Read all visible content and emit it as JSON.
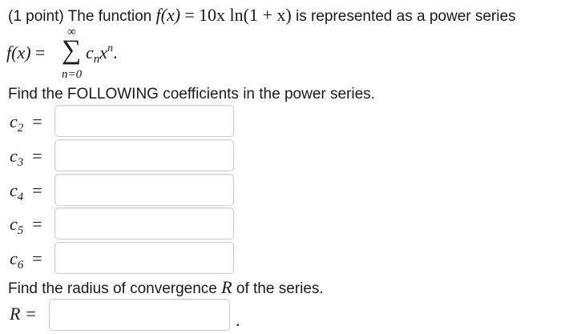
{
  "problem": {
    "points": "(1 point)",
    "intro": "The function",
    "function_lhs": "f(x)",
    "equals": "=",
    "function_rhs": "10x ln(1 + x)",
    "outro": "is represented as a power series"
  },
  "series": {
    "lhs": "f(x)",
    "equals": "=",
    "upper_limit": "∞",
    "sigma": "∑",
    "lower_limit": "n=0",
    "coef": "c",
    "coef_sub": "n",
    "var": "x",
    "var_sup": "n",
    "end": "."
  },
  "instructions": {
    "find_coefficients": "Find the FOLLOWING coefficients in the power series.",
    "find_radius_prefix": "Find the radius of convergence",
    "find_radius_var": "R",
    "find_radius_suffix": "of the series."
  },
  "coefficients": [
    {
      "symbol": "c",
      "index": "2",
      "equals": "=",
      "value": ""
    },
    {
      "symbol": "c",
      "index": "3",
      "equals": "=",
      "value": ""
    },
    {
      "symbol": "c",
      "index": "4",
      "equals": "=",
      "value": ""
    },
    {
      "symbol": "c",
      "index": "5",
      "equals": "=",
      "value": ""
    },
    {
      "symbol": "c",
      "index": "6",
      "equals": "=",
      "value": ""
    }
  ],
  "radius": {
    "label": "R =",
    "value": "",
    "period": "."
  }
}
